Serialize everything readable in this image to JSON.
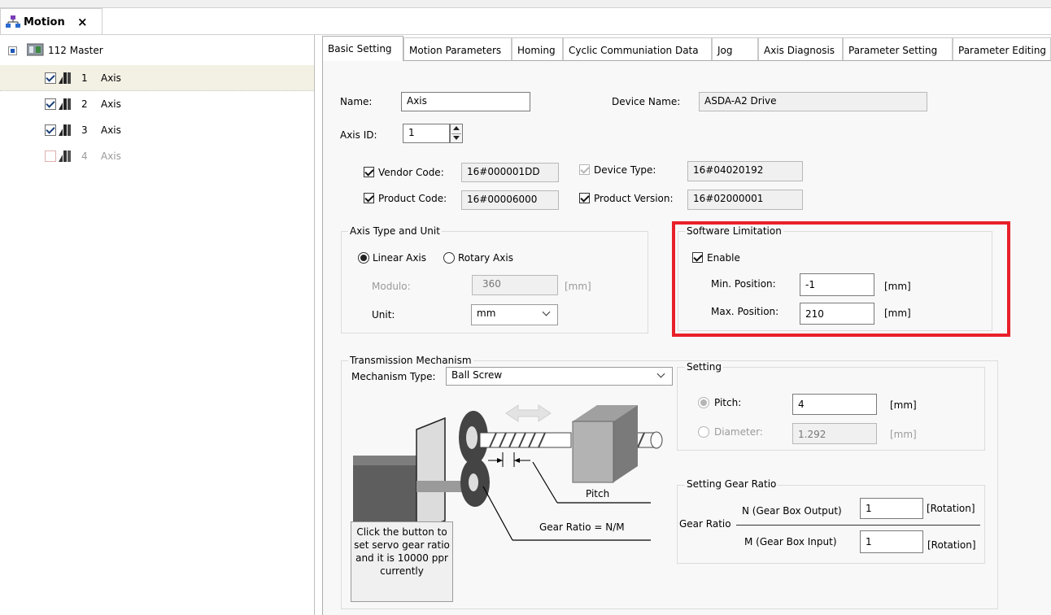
{
  "doc_tab": {
    "title": "Motion",
    "close": "×"
  },
  "tree": {
    "root": "112 Master",
    "items": [
      {
        "num": "1",
        "label": "Axis",
        "checked": true
      },
      {
        "num": "2",
        "label": "Axis",
        "checked": true
      },
      {
        "num": "3",
        "label": "Axis",
        "checked": true
      },
      {
        "num": "4",
        "label": "Axis",
        "checked": false
      }
    ]
  },
  "tabs": [
    "Basic Setting",
    "Motion Parameters",
    "Homing",
    "Cyclic Communiation Data",
    "Jog",
    "Axis Diagnosis",
    "Parameter Setting",
    "Parameter Editing"
  ],
  "basic": {
    "name_label": "Name:",
    "name_value": "Axis",
    "device_name_label": "Device Name:",
    "device_name_value": "ASDA-A2 Drive",
    "axis_id_label": "Axis ID:",
    "axis_id_value": "1",
    "vendor_code_label": "Vendor Code:",
    "vendor_code_value": "16#000001DD",
    "device_type_label": "Device Type:",
    "device_type_value": "16#04020192",
    "product_code_label": "Product Code:",
    "product_code_value": "16#00006000",
    "product_version_label": "Product Version:",
    "product_version_value": "16#02000001"
  },
  "axis_type": {
    "title": "Axis Type and Unit",
    "linear": "Linear Axis",
    "rotary": "Rotary Axis",
    "modulo_label": "Modulo:",
    "modulo_value": "360",
    "modulo_unit": "[mm]",
    "unit_label": "Unit:",
    "unit_value": "mm"
  },
  "software_limitation": {
    "title": "Software Limitation",
    "enable_label": "Enable",
    "min_label": "Min. Position:",
    "min_value": "-1",
    "min_unit": "[mm]",
    "max_label": "Max. Position:",
    "max_value": "210",
    "max_unit": "[mm]",
    "highlight_color": "#e8202a"
  },
  "transmission": {
    "title": "Transmission Mechanism",
    "type_label": "Mechanism Type:",
    "type_value": "Ball Screw",
    "pitch_caption": "Pitch",
    "gear_caption": "Gear Ratio = N/M",
    "button_text": "Click the button to set servo gear ratio and it is 10000 ppr currently"
  },
  "setting": {
    "title": "Setting",
    "pitch_label": "Pitch:",
    "pitch_value": "4",
    "pitch_unit": "[mm]",
    "diameter_label": "Diameter:",
    "diameter_value": "1.292",
    "diameter_unit": "[mm]"
  },
  "gear_ratio": {
    "title": "Setting Gear Ratio",
    "label": "Gear Ratio",
    "n_label": "N (Gear Box Output)",
    "n_value": "1",
    "n_unit": "[Rotation]",
    "m_label": "M (Gear Box Input)",
    "m_value": "1",
    "m_unit": "[Rotation]"
  }
}
